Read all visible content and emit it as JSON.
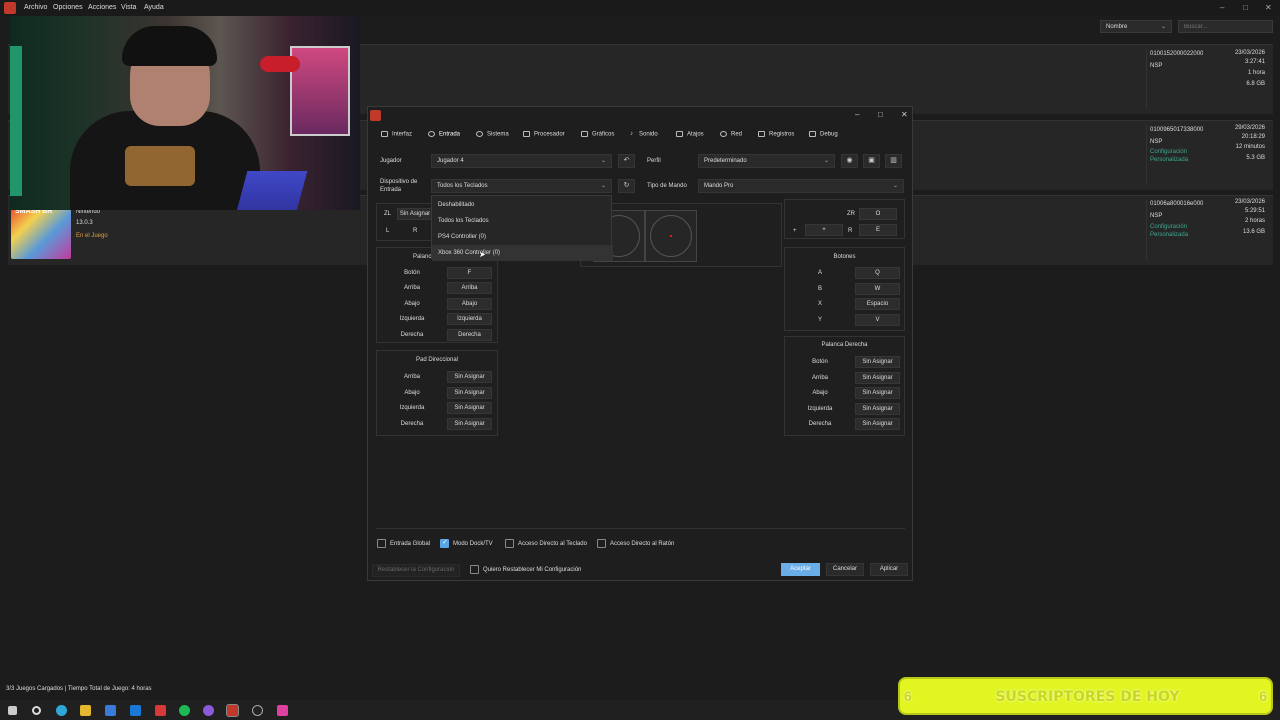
{
  "menubar": {
    "items": [
      "Archivo",
      "Opciones",
      "Acciones",
      "Vista",
      "Ayuda"
    ]
  },
  "window_controls": {
    "minimize": "–",
    "maximize": "□",
    "close": "✕"
  },
  "toolbar": {
    "sort_value": "Nombre",
    "search_placeholder": "Buscar..."
  },
  "games": [
    {
      "id": "0100152000022000",
      "format": "NSP",
      "date": "23/03/2026",
      "time": "3:27:41",
      "playtime": "1 hora",
      "size": "6.8 GB",
      "config": [
        "",
        ""
      ]
    },
    {
      "id": "0100965017338000",
      "format": "NSP",
      "date": "29/03/2026",
      "time": "20:18:29",
      "playtime": "12 minutos",
      "size": "5.3 GB",
      "config": [
        "Configuración",
        "Personalizada"
      ]
    },
    {
      "id": "01006a800016e000",
      "format": "NSP",
      "date": "23/03/2026",
      "time": "5:29:51",
      "playtime": "2 horas",
      "size": "13.6 GB",
      "config": [
        "Configuración",
        "Personalizada"
      ]
    }
  ],
  "smash": {
    "cover_text": "SMASH BR",
    "developer": "Nintendo",
    "version": "13.0.3",
    "status": "En el Juego"
  },
  "statusbar": {
    "text": "3/3 Juegos Cargados | Tiempo Total de Juego: 4 horas"
  },
  "banner": {
    "text": "SUSCRIPTORES DE HOY",
    "left_num": "6",
    "right_num": "6"
  },
  "dialog": {
    "tabs": [
      "Interfaz",
      "Entrada",
      "Sistema",
      "Procesador",
      "Gráficos",
      "Sonido",
      "Atajos",
      "Red",
      "Registros",
      "Debug"
    ],
    "player_label": "Jugador",
    "player_value": "Jugador 4",
    "profile_label": "Perfil",
    "profile_value": "Predeterminado",
    "input_device_label": [
      "Dispositivo de",
      "Entrada"
    ],
    "input_device_value": "Todos los Teclados",
    "controller_type_label": "Tipo de Mando",
    "controller_type_value": "Mando Pro",
    "dropdown_options": [
      "Deshabilitado",
      "Todos los Teclados",
      "PS4 Controller (0)",
      "Xbox 360 Controller (0)"
    ],
    "shoulder_left": {
      "zl": "ZL",
      "zl_value": "Sin Asignar",
      "l": "L",
      "r": "R"
    },
    "shoulder_right": {
      "zr": "ZR",
      "zr_value": "O",
      "plus": "+",
      "plus_value": "+",
      "r": "R",
      "r_value": "E"
    },
    "left_stick": {
      "title": "Palanca Izquierda",
      "rows": [
        {
          "label": "Botón",
          "value": "F"
        },
        {
          "label": "Arriba",
          "value": "Arriba"
        },
        {
          "label": "Abajo",
          "value": "Abajo"
        },
        {
          "label": "Izquierda",
          "value": "Izquierda"
        },
        {
          "label": "Derecha",
          "value": "Derecha"
        }
      ]
    },
    "dpad": {
      "title": "Pad Direccional",
      "rows": [
        {
          "label": "Arriba",
          "value": "Sin Asignar"
        },
        {
          "label": "Abajo",
          "value": "Sin Asignar"
        },
        {
          "label": "Izquierda",
          "value": "Sin Asignar"
        },
        {
          "label": "Derecha",
          "value": "Sin Asignar"
        }
      ]
    },
    "buttons": {
      "title": "Botones",
      "rows": [
        {
          "label": "A",
          "value": "Q"
        },
        {
          "label": "B",
          "value": "W"
        },
        {
          "label": "X",
          "value": "Espacio"
        },
        {
          "label": "Y",
          "value": "V"
        }
      ]
    },
    "right_stick": {
      "title": "Palanca Derecha",
      "rows": [
        {
          "label": "Botón",
          "value": "Sin Asignar"
        },
        {
          "label": "Arriba",
          "value": "Sin Asignar"
        },
        {
          "label": "Abajo",
          "value": "Sin Asignar"
        },
        {
          "label": "Izquierda",
          "value": "Sin Asignar"
        },
        {
          "label": "Derecha",
          "value": "Sin Asignar"
        }
      ]
    },
    "options": [
      {
        "label": "Entrada Global",
        "checked": false
      },
      {
        "label": "Modo Dock/TV",
        "checked": true
      },
      {
        "label": "Acceso Directo al Teclado",
        "checked": false
      },
      {
        "label": "Acceso Directo al Ratón",
        "checked": false
      }
    ],
    "reset_button": "Restablecer la Configuración",
    "reset_confirm_label": "Quiero Restablecer Mi Configuración",
    "accept_button": "Aceptar",
    "cancel_button": "Cancelar",
    "apply_button": "Aplicar"
  },
  "colors": {
    "accent": "#6aaee8",
    "config_text": "#3ea88e",
    "status_in_game": "#e0a040",
    "banner": "#e2f520"
  }
}
